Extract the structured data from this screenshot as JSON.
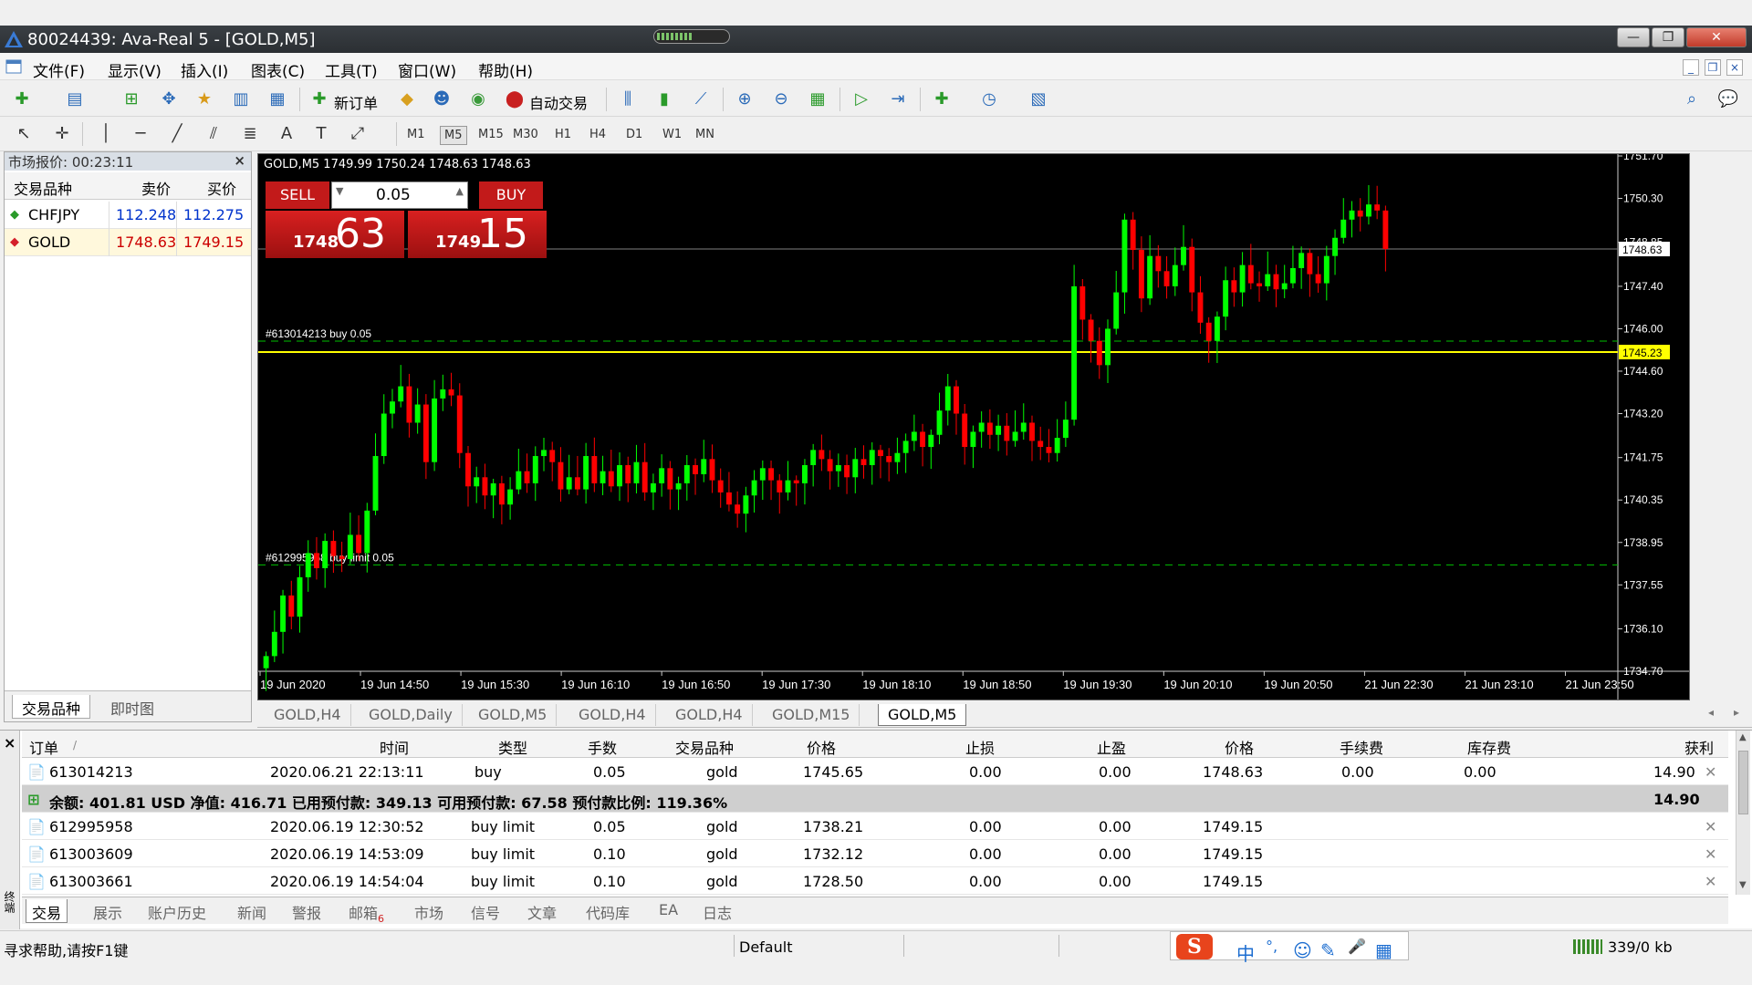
{
  "window": {
    "title": "80024439: Ava-Real 5 - [GOLD,M5]",
    "buttons": [
      "—",
      "❐",
      "✕"
    ]
  },
  "menu": [
    "文件(F)",
    "显示(V)",
    "插入(I)",
    "图表(C)",
    "工具(T)",
    "窗口(W)",
    "帮助(H)"
  ],
  "toolbar": {
    "new_order": "新订单",
    "auto_trade": "自动交易",
    "timeframes": [
      "M1",
      "M5",
      "M15",
      "M30",
      "H1",
      "H4",
      "D1",
      "W1",
      "MN"
    ],
    "active_timeframe": "M5"
  },
  "market_watch": {
    "header": "市场报价: 00:23:11",
    "close": "×",
    "columns": [
      "交易品种",
      "卖价",
      "买价"
    ],
    "rows": [
      {
        "symbol": "CHFJPY",
        "bid": "112.248",
        "ask": "112.275",
        "color": "#0033cc",
        "dir": "up"
      },
      {
        "symbol": "GOLD",
        "bid": "1748.63",
        "ask": "1749.15",
        "color": "#cc0000",
        "dir": "down"
      }
    ],
    "tabs": [
      "交易品种",
      "即时图"
    ]
  },
  "chart": {
    "info": "GOLD,M5  1749.99 1750.24 1748.63 1748.63",
    "one_click": {
      "sell": "SELL",
      "buy": "BUY",
      "lots": "0.05",
      "sell_small": "1748",
      "sell_big": "63",
      "buy_small": "1749",
      "buy_big": "15"
    },
    "order_label_buy": "#613014213 buy 0.05",
    "order_label_limit": "#612995958 buy limit 0.05",
    "current_price_label": "1748.63",
    "order_price_label": "1745.23",
    "colors": {
      "bull": "#00ff00",
      "bear": "#ff0000",
      "order_line": "#ffff00",
      "price_line": "#808080",
      "limit_line": "#00c000"
    }
  },
  "chart_data": {
    "type": "candlestick",
    "symbol": "GOLD",
    "timeframe": "M5",
    "x_tick_labels": [
      "19 Jun 2020",
      "19 Jun 14:50",
      "19 Jun 15:30",
      "19 Jun 16:10",
      "19 Jun 16:50",
      "19 Jun 17:30",
      "19 Jun 18:10",
      "19 Jun 18:50",
      "19 Jun 19:30",
      "19 Jun 20:10",
      "19 Jun 20:50",
      "21 Jun 22:30",
      "21 Jun 23:10",
      "21 Jun 23:50"
    ],
    "y_tick_labels": [
      "1751.70",
      "1750.30",
      "1748.85",
      "1747.40",
      "1746.00",
      "1744.60",
      "1743.20",
      "1741.75",
      "1740.35",
      "1738.95",
      "1737.55",
      "1736.10",
      "1734.70"
    ],
    "ylim": [
      1734.7,
      1751.7
    ],
    "current_bid": 1748.63,
    "order_buy_price": 1745.23,
    "order_buy_limit_price": 1738.21,
    "close_series": [
      1735.2,
      1736.0,
      1737.2,
      1736.5,
      1737.8,
      1738.6,
      1738.1,
      1739.0,
      1738.5,
      1738.4,
      1739.2,
      1738.6,
      1740.0,
      1741.8,
      1743.2,
      1743.6,
      1744.1,
      1742.9,
      1743.5,
      1741.6,
      1743.7,
      1744.0,
      1743.8,
      1741.9,
      1740.8,
      1741.1,
      1740.5,
      1740.9,
      1740.2,
      1740.7,
      1741.3,
      1740.9,
      1741.8,
      1742.0,
      1741.6,
      1740.7,
      1741.1,
      1740.7,
      1741.8,
      1740.9,
      1741.3,
      1740.8,
      1741.5,
      1740.9,
      1741.6,
      1740.6,
      1740.9,
      1741.4,
      1740.7,
      1740.9,
      1741.5,
      1741.2,
      1741.7,
      1741.0,
      1740.6,
      1740.2,
      1739.9,
      1740.5,
      1741.0,
      1741.4,
      1741.0,
      1740.6,
      1741.0,
      1740.9,
      1741.5,
      1742.0,
      1741.7,
      1741.3,
      1741.5,
      1741.1,
      1741.7,
      1741.5,
      1742.0,
      1741.8,
      1741.6,
      1741.9,
      1742.3,
      1742.6,
      1742.1,
      1742.5,
      1743.3,
      1744.1,
      1743.2,
      1742.1,
      1742.6,
      1742.9,
      1742.5,
      1742.8,
      1742.3,
      1742.6,
      1742.9,
      1742.3,
      1742.1,
      1741.9,
      1742.4,
      1743.0,
      1747.4,
      1746.3,
      1745.6,
      1744.8,
      1746.0,
      1747.2,
      1749.6,
      1748.6,
      1747.0,
      1748.4,
      1747.9,
      1747.4,
      1748.1,
      1748.7,
      1747.2,
      1746.2,
      1745.6,
      1746.4,
      1747.6,
      1747.2,
      1748.1,
      1747.5,
      1747.4,
      1747.8,
      1747.3,
      1747.5,
      1748.0,
      1748.5,
      1747.8,
      1747.5,
      1748.4,
      1749.0,
      1749.6,
      1749.9,
      1749.7,
      1750.1,
      1749.9,
      1748.63
    ]
  },
  "chart_tabs": [
    "GOLD,H4",
    "GOLD,Daily",
    "GOLD,M5",
    "GOLD,H4",
    "GOLD,H4",
    "GOLD,M15",
    "GOLD,M5"
  ],
  "terminal": {
    "columns": [
      "订单",
      "时间",
      "类型",
      "手数",
      "交易品种",
      "价格",
      "止损",
      "止盈",
      "价格",
      "手续费",
      "库存费",
      "获利"
    ],
    "sort_mark": "/",
    "open_trades": [
      {
        "order": "613014213",
        "time": "2020.06.21 22:13:11",
        "type": "buy",
        "lots": "0.05",
        "symbol": "gold",
        "price": "1745.65",
        "sl": "0.00",
        "tp": "0.00",
        "cur": "1748.63",
        "commission": "0.00",
        "swap": "0.00",
        "profit": "14.90"
      }
    ],
    "summary": "余额: 401.81 USD  净值: 416.71  已用预付款: 349.13  可用预付款: 67.58  预付款比例: 119.36%",
    "summary_profit": "14.90",
    "pending": [
      {
        "order": "612995958",
        "time": "2020.06.19 12:30:52",
        "type": "buy limit",
        "lots": "0.05",
        "symbol": "gold",
        "price": "1738.21",
        "sl": "0.00",
        "tp": "0.00",
        "cur": "1749.15"
      },
      {
        "order": "613003609",
        "time": "2020.06.19 14:53:09",
        "type": "buy limit",
        "lots": "0.10",
        "symbol": "gold",
        "price": "1732.12",
        "sl": "0.00",
        "tp": "0.00",
        "cur": "1749.15"
      },
      {
        "order": "613003661",
        "time": "2020.06.19 14:54:04",
        "type": "buy limit",
        "lots": "0.10",
        "symbol": "gold",
        "price": "1728.50",
        "sl": "0.00",
        "tp": "0.00",
        "cur": "1749.15"
      }
    ],
    "tabs": [
      "交易",
      "展示",
      "账户历史",
      "新闻",
      "警报",
      "邮箱",
      "市场",
      "信号",
      "文章",
      "代码库",
      "EA",
      "日志"
    ],
    "mail_count": "6",
    "side_label": "终端"
  },
  "status": {
    "help": "寻求帮助,请按F1键",
    "profile": "Default",
    "traffic": "339/0 kb",
    "ime_logo": "S",
    "ime_chars": [
      "中",
      "°,",
      "☺",
      "✎",
      "🎤",
      "▦"
    ]
  }
}
